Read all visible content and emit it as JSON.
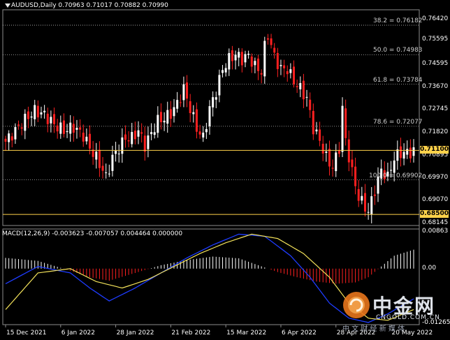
{
  "header": {
    "symbol": "AUDUSD,Daily",
    "ohlc": "0.70963 0.71017 0.70882 0.70990"
  },
  "macd_header": "MACD(12,26,9) -0.003623 -0.007057 0.004464 0.000000",
  "fib_levels": [
    {
      "label": "38.2 = 0.76182",
      "price": 0.76182
    },
    {
      "label": "50.0 = 0.74983",
      "price": 0.74983
    },
    {
      "label": "61.8 = 0.73784",
      "price": 0.73784
    },
    {
      "label": "78.6 = 0.72077",
      "price": 0.72077
    },
    {
      "label": "100.0 = 0.69902",
      "price": 0.69902
    }
  ],
  "price_axis": [
    "0.76420",
    "0.75595",
    "0.74595",
    "0.73670",
    "0.72745",
    "0.71820",
    "0.70895",
    "0.69970",
    "0.69070",
    "0.68145"
  ],
  "current_price": {
    "label": "0.71100",
    "value": 0.711,
    "color": "#ffd24a"
  },
  "support_price": {
    "label": "0.68500",
    "value": 0.685,
    "color": "#ffd24a"
  },
  "macd_axis": [
    "0.00863",
    "0.00",
    "-0.012657"
  ],
  "dates": [
    "15 Dec 2021",
    "6 Jan 2022",
    "28 Jan 2022",
    "21 Feb 2022",
    "15 Mar 2022",
    "6 Apr 2022",
    "28 Apr 2022",
    "20 May 2022"
  ],
  "watermark": {
    "name": "中金网",
    "domain": "CNGOLD.COM.CN",
    "slogan": "中 文 财 经 新 媒 体"
  },
  "colors": {
    "bull": "#ffffff",
    "bear": "#ff2020",
    "hist_pos": "#ffffff",
    "hist_neg": "#ff2020",
    "macd_line": "#1e3cff",
    "signal_line": "#f3e25a",
    "grid": "#8c8c8c"
  },
  "chart_data": {
    "type": "candlestick",
    "title": "AUDUSD,Daily",
    "ylim": [
      0.6805,
      0.7675
    ],
    "x": [
      "15 Dec 2021",
      "6 Jan 2022",
      "28 Jan 2022",
      "21 Feb 2022",
      "15 Mar 2022",
      "6 Apr 2022",
      "28 Apr 2022",
      "20 May 2022"
    ],
    "close_path": [
      [
        0,
        0.7145
      ],
      [
        3,
        0.719
      ],
      [
        6,
        0.7235
      ],
      [
        9,
        0.727
      ],
      [
        12,
        0.7255
      ],
      [
        15,
        0.7215
      ],
      [
        18,
        0.719
      ],
      [
        21,
        0.7205
      ],
      [
        24,
        0.717
      ],
      [
        26,
        0.712
      ],
      [
        28,
        0.708
      ],
      [
        30,
        0.703
      ],
      [
        31,
        0.7
      ],
      [
        33,
        0.708
      ],
      [
        35,
        0.712
      ],
      [
        37,
        0.716
      ],
      [
        39,
        0.716
      ],
      [
        41,
        0.719
      ],
      [
        43,
        0.713
      ],
      [
        45,
        0.718
      ],
      [
        47,
        0.723
      ],
      [
        49,
        0.724
      ],
      [
        51,
        0.726
      ],
      [
        53,
        0.73
      ],
      [
        55,
        0.736
      ],
      [
        57,
        0.728
      ],
      [
        59,
        0.72
      ],
      [
        61,
        0.716
      ],
      [
        63,
        0.728
      ],
      [
        65,
        0.735
      ],
      [
        67,
        0.744
      ],
      [
        69,
        0.748
      ],
      [
        71,
        0.75
      ],
      [
        73,
        0.748
      ],
      [
        75,
        0.7495
      ],
      [
        77,
        0.745
      ],
      [
        79,
        0.743
      ],
      [
        80,
        0.753
      ],
      [
        81,
        0.758
      ],
      [
        83,
        0.749
      ],
      [
        85,
        0.744
      ],
      [
        87,
        0.744
      ],
      [
        89,
        0.739
      ],
      [
        91,
        0.736
      ],
      [
        93,
        0.732
      ],
      [
        95,
        0.72
      ],
      [
        97,
        0.715
      ],
      [
        99,
        0.708
      ],
      [
        101,
        0.704
      ],
      [
        103,
        0.712
      ],
      [
        104,
        0.728
      ],
      [
        105,
        0.715
      ],
      [
        107,
        0.702
      ],
      [
        109,
        0.692
      ],
      [
        111,
        0.688
      ],
      [
        112,
        0.686
      ],
      [
        114,
        0.695
      ],
      [
        116,
        0.703
      ],
      [
        118,
        0.7
      ],
      [
        120,
        0.708
      ],
      [
        122,
        0.71
      ],
      [
        124,
        0.71
      ],
      [
        126,
        0.7105
      ]
    ],
    "macd_ylim": [
      -0.013,
      0.0092
    ],
    "macd_line": [
      [
        0,
        -0.0035
      ],
      [
        10,
        0.0005
      ],
      [
        20,
        -0.001
      ],
      [
        26,
        -0.0045
      ],
      [
        32,
        -0.0075
      ],
      [
        40,
        -0.0045
      ],
      [
        48,
        -0.001
      ],
      [
        56,
        0.0025
      ],
      [
        64,
        0.0055
      ],
      [
        72,
        0.008
      ],
      [
        80,
        0.0075
      ],
      [
        88,
        0.003
      ],
      [
        94,
        -0.002
      ],
      [
        100,
        -0.008
      ],
      [
        106,
        -0.0115
      ],
      [
        112,
        -0.0125
      ],
      [
        118,
        -0.0105
      ],
      [
        126,
        -0.007
      ]
    ],
    "signal_line": [
      [
        0,
        -0.0095
      ],
      [
        10,
        -0.001
      ],
      [
        20,
        0.0
      ],
      [
        28,
        -0.003
      ],
      [
        36,
        -0.0045
      ],
      [
        44,
        -0.0025
      ],
      [
        52,
        0.0005
      ],
      [
        60,
        0.0035
      ],
      [
        68,
        0.006
      ],
      [
        76,
        0.008
      ],
      [
        84,
        0.007
      ],
      [
        92,
        0.0035
      ],
      [
        100,
        -0.002
      ],
      [
        106,
        -0.008
      ],
      [
        112,
        -0.0115
      ],
      [
        118,
        -0.012
      ],
      [
        126,
        -0.0095
      ]
    ],
    "histogram": [
      [
        0,
        0.0025
      ],
      [
        10,
        0.0018
      ],
      [
        20,
        -0.0005
      ],
      [
        26,
        -0.002
      ],
      [
        32,
        -0.0028
      ],
      [
        40,
        -0.001
      ],
      [
        48,
        0.0008
      ],
      [
        56,
        0.002
      ],
      [
        64,
        0.0028
      ],
      [
        72,
        0.0024
      ],
      [
        78,
        0.0008
      ],
      [
        84,
        -0.0008
      ],
      [
        90,
        -0.002
      ],
      [
        96,
        -0.003
      ],
      [
        102,
        -0.0035
      ],
      [
        108,
        -0.0032
      ],
      [
        112,
        -0.002
      ],
      [
        116,
        0.0005
      ],
      [
        120,
        0.003
      ],
      [
        126,
        0.0044
      ]
    ]
  }
}
